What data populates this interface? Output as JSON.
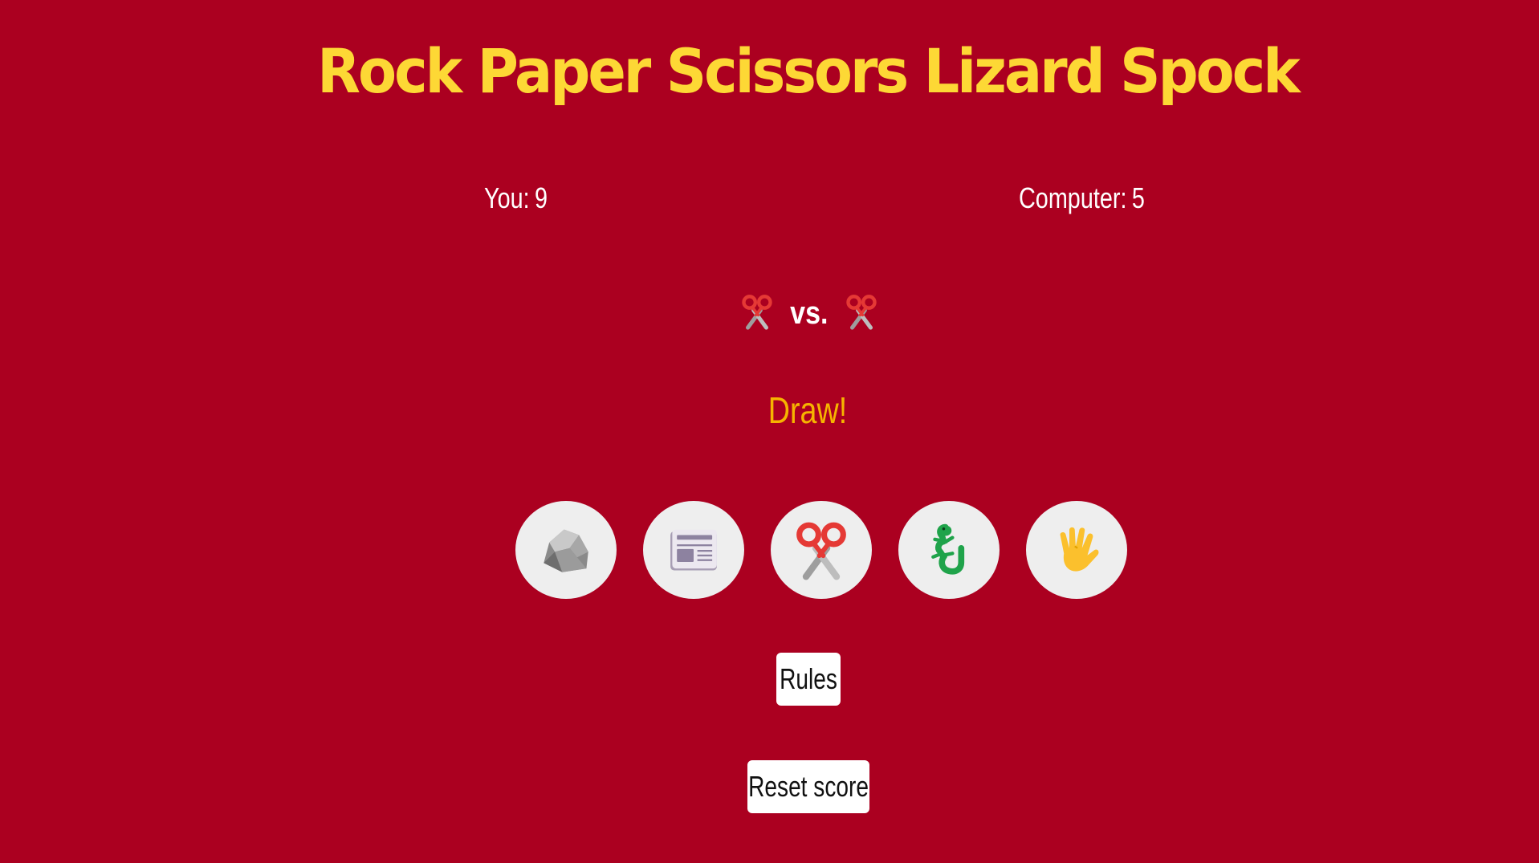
{
  "game": {
    "title": "Rock Paper Scissors Lizard Spock"
  },
  "score": {
    "you_label": "You:",
    "you_value": "9",
    "computer_label": "Computer:",
    "computer_value": "5"
  },
  "matchup": {
    "player_choice_icon": "scissors-icon",
    "vs_label": "vs.",
    "computer_choice_icon": "scissors-icon"
  },
  "result": {
    "text": "Draw!"
  },
  "choices": [
    {
      "name": "rock",
      "icon": "rock-icon"
    },
    {
      "name": "paper",
      "icon": "newspaper-icon"
    },
    {
      "name": "scissors",
      "icon": "scissors-icon"
    },
    {
      "name": "lizard",
      "icon": "lizard-icon"
    },
    {
      "name": "spock",
      "icon": "vulcan-salute-icon"
    }
  ],
  "buttons": {
    "rules_label": "Rules",
    "reset_label": "Reset score"
  },
  "colors": {
    "background": "#ab0020",
    "title": "#fdd835",
    "result": "#f6b400",
    "choice_bg": "#eeeeee"
  }
}
